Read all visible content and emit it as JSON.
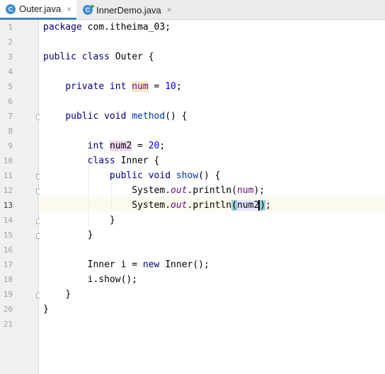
{
  "tabs": [
    {
      "label": "Outer.java",
      "icon": "class-icon",
      "active": true,
      "close": "×"
    },
    {
      "label": "InnerDemo.java",
      "icon": "runnable-class-icon",
      "active": false,
      "close": "×"
    }
  ],
  "editor": {
    "current_line": 13,
    "line_numbers": [
      "1",
      "2",
      "3",
      "4",
      "5",
      "6",
      "7",
      "8",
      "9",
      "10",
      "11",
      "12",
      "13",
      "14",
      "15",
      "16",
      "17",
      "18",
      "19",
      "20",
      "21"
    ],
    "code": {
      "l1_kw": "package",
      "l1_rest": " com.itheima_03;",
      "l3_kw": "public class",
      "l3_rest": " Outer {",
      "l5_kw": "private int",
      "l5_var": "num",
      "l5_eq": " = ",
      "l5_val": "10",
      "l5_end": ";",
      "l7_kw": "public void",
      "l7_name": "method",
      "l7_rest": "() {",
      "l9_kw": "int",
      "l9_var": "num2",
      "l9_eq": " = ",
      "l9_val": "20",
      "l9_end": ";",
      "l10_kw": "class",
      "l10_rest": " Inner {",
      "l11_kw": "public void",
      "l11_name": "show",
      "l11_rest": "() {",
      "l12_a": "System.",
      "l12_out": "out",
      "l12_b": ".println(",
      "l12_var": "num",
      "l12_c": ");",
      "l13_a": "System.",
      "l13_out": "out",
      "l13_b": ".println",
      "l13_open": "(",
      "l13_var": "num2",
      "l13_close": ")",
      "l13_end": ";",
      "l14": "}",
      "l15": "}",
      "l17_a": "Inner i = ",
      "l17_kw": "new",
      "l17_b": " Inner();",
      "l18": "i.show();",
      "l19": "}",
      "l20": "}"
    }
  },
  "colors": {
    "keyword": "#000080",
    "number": "#0000ff",
    "field": "#660e7a",
    "tab_accent": "#4083c9",
    "current_line_bg": "#fcfaed"
  }
}
